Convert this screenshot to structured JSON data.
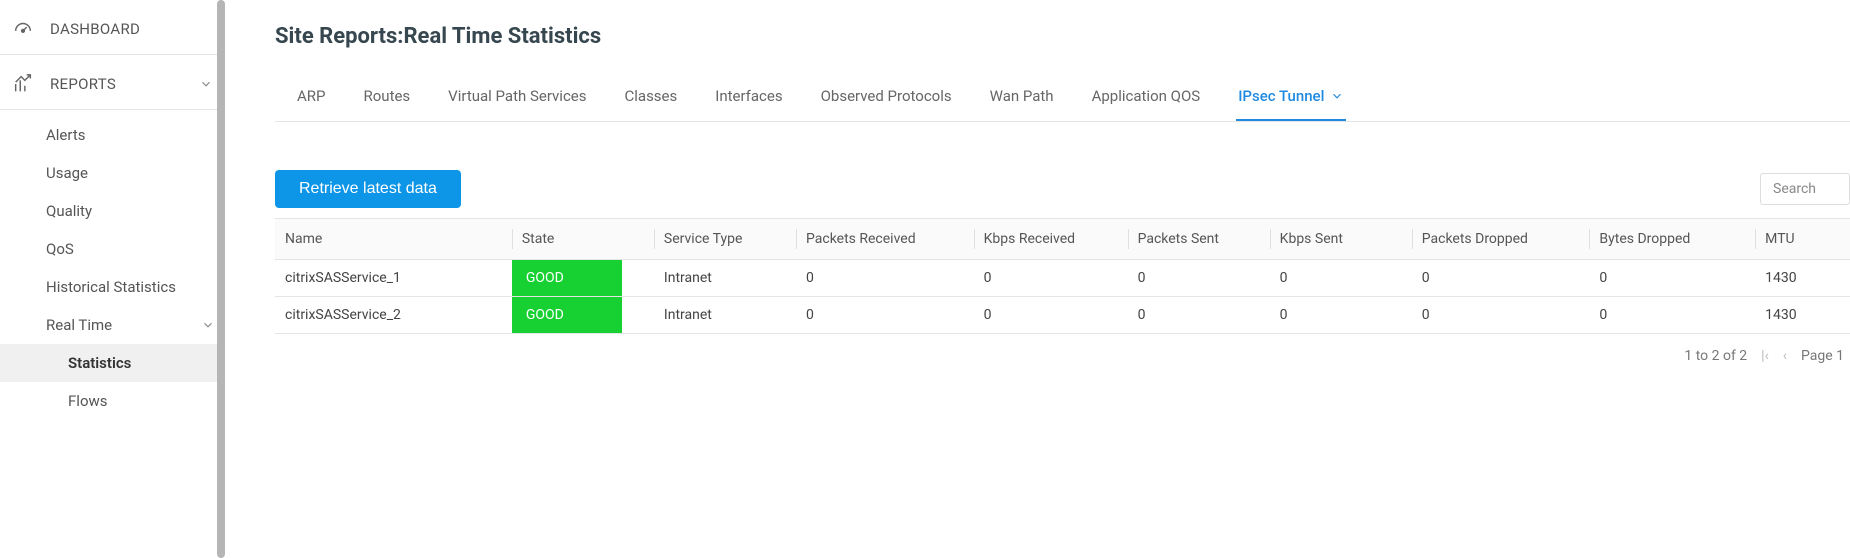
{
  "sidebar": {
    "dashboard": "DASHBOARD",
    "reports": "REPORTS",
    "items": [
      {
        "label": "Alerts"
      },
      {
        "label": "Usage"
      },
      {
        "label": "Quality"
      },
      {
        "label": "QoS"
      },
      {
        "label": "Historical Statistics"
      },
      {
        "label": "Real Time"
      }
    ],
    "realtime_children": [
      {
        "label": "Statistics"
      },
      {
        "label": "Flows"
      }
    ]
  },
  "page": {
    "title": "Site Reports:Real Time Statistics"
  },
  "tabs": [
    {
      "label": "ARP"
    },
    {
      "label": "Routes"
    },
    {
      "label": "Virtual Path Services"
    },
    {
      "label": "Classes"
    },
    {
      "label": "Interfaces"
    },
    {
      "label": "Observed Protocols"
    },
    {
      "label": "Wan Path"
    },
    {
      "label": "Application QOS"
    },
    {
      "label": "IPsec Tunnel"
    }
  ],
  "toolbar": {
    "retrieve": "Retrieve latest data",
    "search_placeholder": "Search"
  },
  "table": {
    "headers": [
      "Name",
      "State",
      "Service Type",
      "Packets Received",
      "Kbps Received",
      "Packets Sent",
      "Kbps Sent",
      "Packets Dropped",
      "Bytes Dropped",
      "MTU"
    ],
    "rows": [
      {
        "name": "citrixSASService_1",
        "state": "GOOD",
        "service_type": "Intranet",
        "packets_received": "0",
        "kbps_received": "0",
        "packets_sent": "0",
        "kbps_sent": "0",
        "packets_dropped": "0",
        "bytes_dropped": "0",
        "mtu": "1430"
      },
      {
        "name": "citrixSASService_2",
        "state": "GOOD",
        "service_type": "Intranet",
        "packets_received": "0",
        "kbps_received": "0",
        "packets_sent": "0",
        "kbps_sent": "0",
        "packets_dropped": "0",
        "bytes_dropped": "0",
        "mtu": "1430"
      }
    ]
  },
  "pager": {
    "range": "1 to 2 of 2",
    "page": "Page 1"
  }
}
